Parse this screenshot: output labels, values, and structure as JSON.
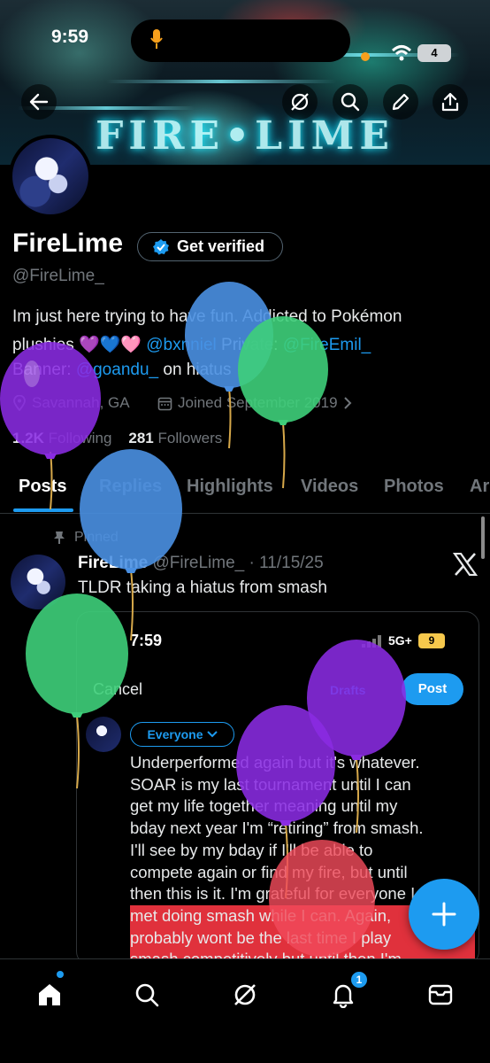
{
  "status_bar": {
    "time": "9:59",
    "battery": "4"
  },
  "banner": {
    "title": "FIRE•LIME"
  },
  "profile": {
    "name": "FireLime",
    "get_verified": "Get verified",
    "handle": "@FireLime_",
    "bio_line1": "Im just here trying to have fun. Addicted to Pokémon",
    "bio_line2_pre": "plushies 💜💙🩷 ",
    "bio_line2_link1": "@bxnniel",
    "bio_line2_mid": " Private: ",
    "bio_line2_link2": "@FireEmil_",
    "bio_line3_pre": "Banner: ",
    "bio_line3_link": "@goandu_",
    "bio_line3_post": " on hiatus",
    "location": "Savannah, GA",
    "joined": "Joined September 2019",
    "following_count": "1.2K",
    "following_label": "Following",
    "followers_count": "281",
    "followers_label": "Followers"
  },
  "tabs": [
    "Posts",
    "Replies",
    "Highlights",
    "Videos",
    "Photos",
    "Ar"
  ],
  "post": {
    "pinned_label": "Pinned",
    "author": "FireLime",
    "handle": "@FireLime_",
    "date": "· 11/15/25",
    "text": "TLDR taking a hiatus from smash",
    "embed": {
      "time": "7:59",
      "network": "5G+",
      "battery": "9",
      "cancel": "Cancel",
      "drafts": "Drafts",
      "post_button": "Post",
      "audience": "Everyone",
      "lines": [
        "Underperformed again but it's whatever.",
        "SOAR is my last tournament until I can",
        "get my life together meaning until my",
        "bday next year I'm “retiring” from smash.",
        "I'll see by my bday if I'll be able to",
        "compete again or find my fire, but until",
        "then this is it. I'm grateful for everyone I",
        "met doing smash while I can. Again,",
        "probably wont be the last time I play",
        "smash competitively but until then I'm"
      ]
    }
  },
  "bottom_nav": {
    "notification_count": "1"
  },
  "colors": {
    "accent": "#1d9bf0",
    "background": "#000000",
    "muted": "#71767b"
  }
}
